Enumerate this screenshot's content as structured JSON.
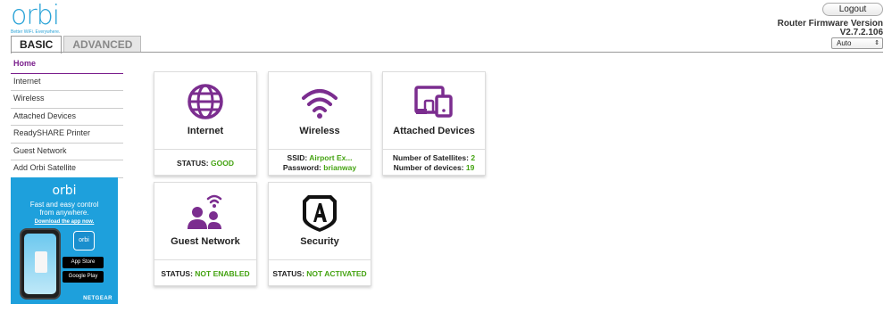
{
  "brand": {
    "logo": "orbi",
    "tagline": "Better WiFi. Everywhere."
  },
  "tabs": [
    {
      "label": "BASIC",
      "active": true
    },
    {
      "label": "ADVANCED",
      "active": false
    }
  ],
  "header": {
    "logout_label": "Logout",
    "firmware_label": "Router Firmware Version",
    "firmware_version": "V2.7.2.106",
    "language_value": "Auto"
  },
  "sidebar": {
    "items": [
      {
        "label": "Home",
        "active": true
      },
      {
        "label": "Internet"
      },
      {
        "label": "Wireless"
      },
      {
        "label": "Attached Devices"
      },
      {
        "label": "ReadySHARE Printer"
      },
      {
        "label": "Guest Network"
      },
      {
        "label": "Add Orbi Satellite"
      }
    ]
  },
  "promo": {
    "logo": "orbi",
    "line1": "Fast and easy control",
    "line2": "from anywhere.",
    "link": "Download the app now.",
    "app_icon_text": "orbi",
    "app_store": "App Store",
    "google_play": "Google Play",
    "brand": "NETGEAR"
  },
  "cards": {
    "internet": {
      "title": "Internet",
      "status_label": "STATUS:",
      "status_value": "GOOD",
      "icon": "globe-icon"
    },
    "wireless": {
      "title": "Wireless",
      "ssid_label": "SSID:",
      "ssid_value": "Airport Ex...",
      "password_label": "Password:",
      "password_value": "brianway",
      "icon": "wifi-icon"
    },
    "attached": {
      "title": "Attached Devices",
      "satellites_label": "Number of Satellites:",
      "satellites_value": "2",
      "devices_label": "Number of devices:",
      "devices_value": "19",
      "icon": "devices-icon"
    },
    "guest": {
      "title": "Guest Network",
      "status_label": "STATUS:",
      "status_value": "NOT ENABLED",
      "icon": "guest-users-icon"
    },
    "security": {
      "title": "Security",
      "status_label": "STATUS:",
      "status_value": "NOT ACTIVATED",
      "icon": "armor-shield-icon"
    }
  },
  "colors": {
    "accent": "#7a1e8c",
    "icon_purple": "#7b2d8f",
    "status_green": "#44a311",
    "brand_blue": "#2aa3d7"
  }
}
